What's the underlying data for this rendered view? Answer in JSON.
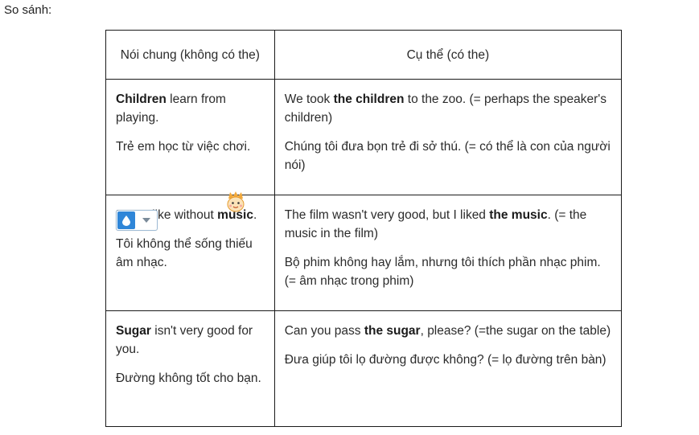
{
  "intro": "So sánh:",
  "table": {
    "headers": [
      "Nói chung (không có the)",
      "Cụ thể (có the)"
    ],
    "rows": [
      {
        "general_en_bold": "Children",
        "general_en_rest": " learn from playing.",
        "general_vi": "Trẻ em học từ việc chơi.",
        "specific_en_pre": "We took ",
        "specific_en_bold": "the children",
        "specific_en_post": " to the zoo. (= perhaps the speaker's children)",
        "specific_vi": "Chúng tôi đưa bọn trẻ đi sở thú. (= có thể là con của người nói)"
      },
      {
        "general_en_pre": "I can't like without ",
        "general_en_bold": "music",
        "general_en_post": ".",
        "general_vi": "Tôi không thể sống thiếu âm nhạc.",
        "specific_en_pre": "The film wasn't very good, but I liked ",
        "specific_en_bold": "the music",
        "specific_en_post": ". (= the music in the film)",
        "specific_vi": "Bộ phim không hay lắm, nhưng tôi thích phần nhạc phim. (= âm nhạc trong phim)"
      },
      {
        "general_en_bold": "Sugar",
        "general_en_rest": " isn't very good for you.",
        "general_vi": "Đường không tốt cho bạn.",
        "specific_en_pre": "Can you pass ",
        "specific_en_bold": "the sugar",
        "specific_en_post": ", please? (=the sugar on the table)",
        "specific_vi": "Đưa giúp tôi lọ đường được không? (= lọ đường trên bàn)"
      }
    ]
  },
  "overlay": {
    "widget_icon": "water-drop-icon",
    "dropdown_icon": "chevron-down-icon",
    "mascot_icon": "cartoon-mascot-icon",
    "accent": "#2f86d8"
  }
}
